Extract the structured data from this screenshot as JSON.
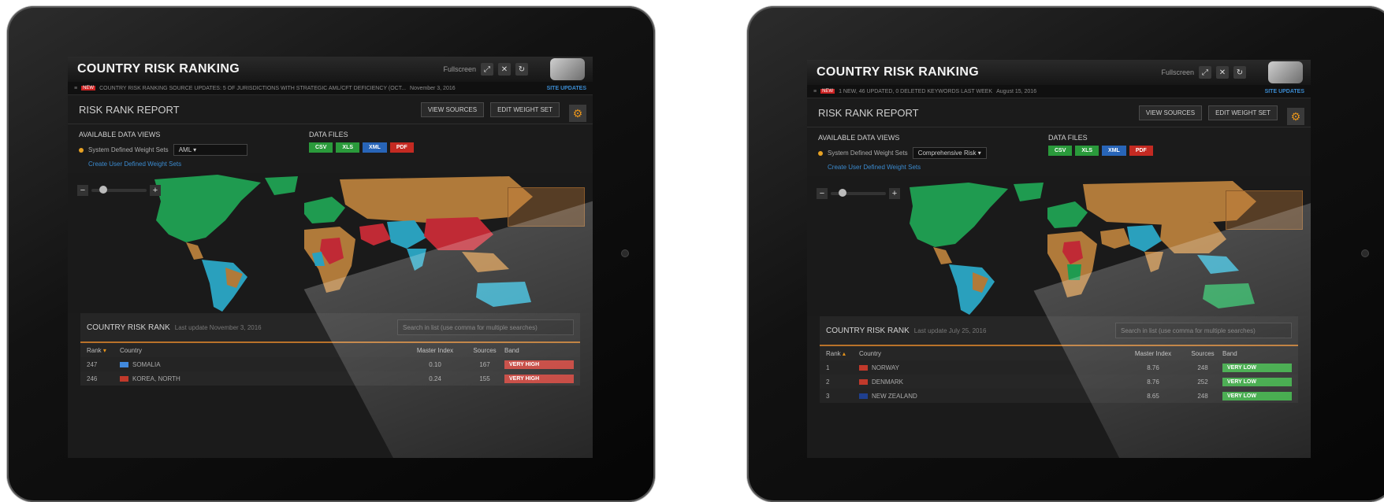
{
  "screens": [
    {
      "app_title": "COUNTRY RISK RANKING",
      "fullscreen_label": "Fullscreen",
      "ticker": {
        "badge": "NEW",
        "text": "COUNTRY RISK RANKING SOURCE UPDATES: 5 OF JURISDICTIONS WITH STRATEGIC AML/CFT DEFICIENCY (OCT...",
        "date": "November 3, 2016",
        "site_updates": "SITE UPDATES"
      },
      "report_title": "RISK RANK REPORT",
      "view_sources": "VIEW SOURCES",
      "edit_weight_set": "EDIT WEIGHT SET",
      "data_views_title": "AVAILABLE DATA VIEWS",
      "weight_set_label": "System Defined Weight Sets",
      "weight_set_value": "AML",
      "create_link": "Create User Defined Weight Sets",
      "data_files_title": "DATA FILES",
      "files": [
        "CSV",
        "XLS",
        "XML",
        "PDF"
      ],
      "rank_title": "COUNTRY RISK RANK",
      "rank_updated": "Last update November 3, 2016",
      "search_placeholder": "Search in list (use comma for multiple searches)",
      "columns": [
        "Rank",
        "Country",
        "Master Index",
        "Sources",
        "Band"
      ],
      "rows": [
        {
          "rank": "247",
          "country": "SOMALIA",
          "index": "0.10",
          "sources": "167",
          "band": "VERY HIGH",
          "band_color": "#c23a32",
          "flag_color": "#4189dd"
        },
        {
          "rank": "246",
          "country": "KOREA, NORTH",
          "index": "0.24",
          "sources": "155",
          "band": "VERY HIGH",
          "band_color": "#c23a32",
          "flag_color": "#c0392b"
        }
      ]
    },
    {
      "app_title": "COUNTRY RISK RANKING",
      "fullscreen_label": "Fullscreen",
      "ticker": {
        "badge": "NEW",
        "text": "1 NEW, 46 UPDATED, 0 DELETED KEYWORDS LAST WEEK",
        "date": "August 15, 2016",
        "site_updates": "SITE UPDATES"
      },
      "report_title": "RISK RANK REPORT",
      "view_sources": "VIEW SOURCES",
      "edit_weight_set": "EDIT WEIGHT SET",
      "data_views_title": "AVAILABLE DATA VIEWS",
      "weight_set_label": "System Defined Weight Sets",
      "weight_set_value": "Comprehensive Risk",
      "create_link": "Create User Defined Weight Sets",
      "data_files_title": "DATA FILES",
      "files": [
        "CSV",
        "XLS",
        "XML",
        "PDF"
      ],
      "rank_title": "COUNTRY RISK RANK",
      "rank_updated": "Last update July 25, 2016",
      "search_placeholder": "Search in list (use comma for multiple searches)",
      "columns": [
        "Rank",
        "Country",
        "Master Index",
        "Sources",
        "Band"
      ],
      "rows": [
        {
          "rank": "1",
          "country": "NORWAY",
          "index": "8.76",
          "sources": "248",
          "band": "VERY LOW",
          "band_color": "#36a53f",
          "flag_color": "#c0392b"
        },
        {
          "rank": "2",
          "country": "DENMARK",
          "index": "8.76",
          "sources": "252",
          "band": "VERY LOW",
          "band_color": "#36a53f",
          "flag_color": "#c0392b"
        },
        {
          "rank": "3",
          "country": "NEW ZEALAND",
          "index": "8.65",
          "sources": "248",
          "band": "VERY LOW",
          "band_color": "#36a53f",
          "flag_color": "#1f3f8f"
        }
      ]
    }
  ],
  "colors": {
    "accent": "#e7941b",
    "link": "#3b8bd0",
    "map_green": "#1f9b50",
    "map_orange": "#b07a3a",
    "map_blue": "#2aa0bd",
    "map_red": "#c02a35"
  }
}
